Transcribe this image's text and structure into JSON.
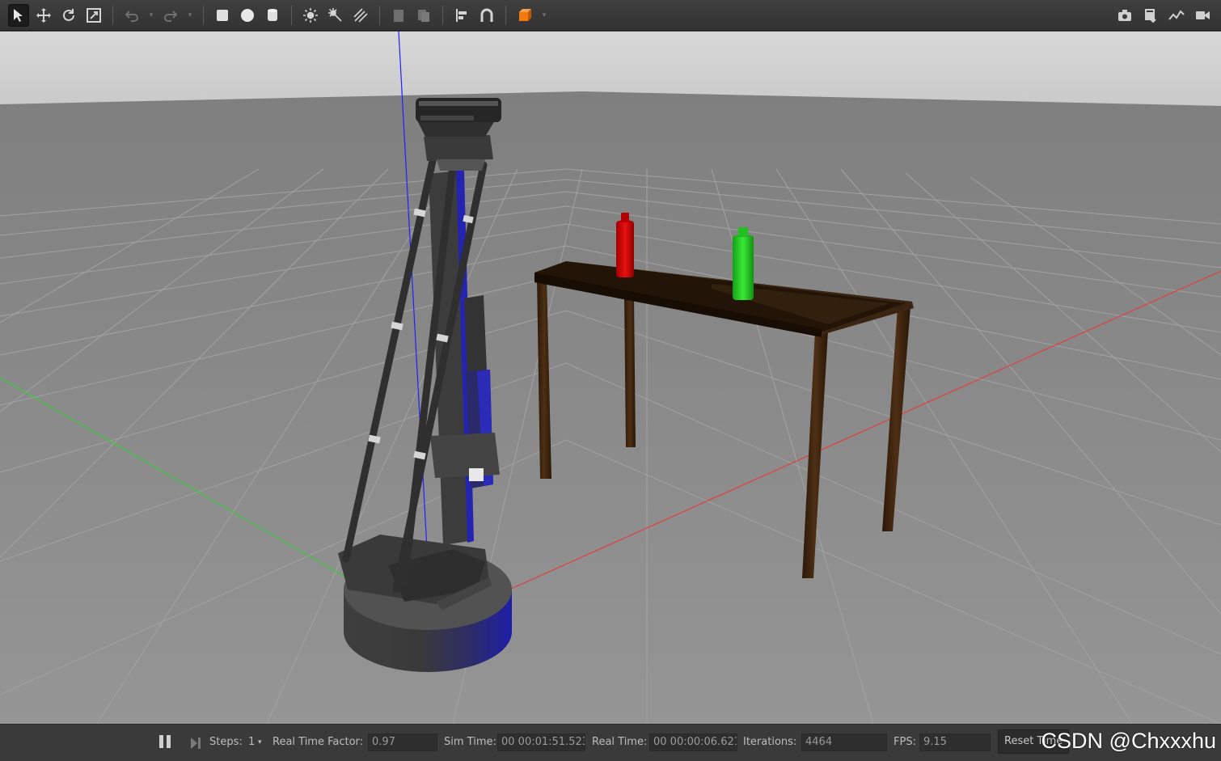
{
  "toolbar": {
    "tools": [
      {
        "name": "select-mode",
        "icon": "arrow-cursor-icon",
        "active": true
      },
      {
        "name": "translate-mode",
        "icon": "move-icon"
      },
      {
        "name": "rotate-mode",
        "icon": "rotate-icon"
      },
      {
        "name": "scale-mode",
        "icon": "scale-icon"
      },
      {
        "name": "undo",
        "icon": "undo-icon",
        "disabled": true
      },
      {
        "name": "redo",
        "icon": "redo-icon",
        "disabled": true
      },
      {
        "name": "box-shape",
        "icon": "box-icon"
      },
      {
        "name": "sphere-shape",
        "icon": "sphere-icon"
      },
      {
        "name": "cylinder-shape",
        "icon": "cylinder-icon"
      },
      {
        "name": "point-light",
        "icon": "point-light-icon"
      },
      {
        "name": "spot-light",
        "icon": "spot-light-icon"
      },
      {
        "name": "directional-light",
        "icon": "directional-light-icon"
      },
      {
        "name": "copy",
        "icon": "copy-icon",
        "disabled": true
      },
      {
        "name": "paste",
        "icon": "paste-icon",
        "disabled": true
      },
      {
        "name": "align",
        "icon": "align-icon"
      },
      {
        "name": "snap",
        "icon": "magnet-icon"
      },
      {
        "name": "view-angle",
        "icon": "view-cube-icon"
      }
    ],
    "right_tools": [
      {
        "name": "screenshot",
        "icon": "camera-icon"
      },
      {
        "name": "log",
        "icon": "log-icon"
      },
      {
        "name": "plot",
        "icon": "plot-icon"
      },
      {
        "name": "record-video",
        "icon": "video-camera-icon"
      }
    ]
  },
  "colors": {
    "toolbar_bg": "#3a3a3a",
    "ground": "#8f8f8f",
    "sky": "#d6d6d6",
    "red_bottle": "#d40000",
    "green_bottle": "#22cc22",
    "table_wood": "#2b1a0c",
    "robot_dark": "#3d3d3d",
    "robot_accent": "#2222aa",
    "x_axis": "#e03030",
    "y_axis": "#30c030",
    "z_axis": "#2020ff"
  },
  "statusbar": {
    "steps_label": "Steps:",
    "steps_value": "1",
    "rtf_label": "Real Time Factor:",
    "rtf_value": "0.97",
    "sim_time_label": "Sim Time:",
    "sim_time_value": "00 00:01:51.523",
    "real_time_label": "Real Time:",
    "real_time_value": "00 00:00:06.621",
    "iterations_label": "Iterations:",
    "iterations_value": "4464",
    "fps_label": "FPS:",
    "fps_value": "9.15",
    "reset_label": "Reset Time"
  },
  "watermark": "CSDN @Chxxxhu"
}
